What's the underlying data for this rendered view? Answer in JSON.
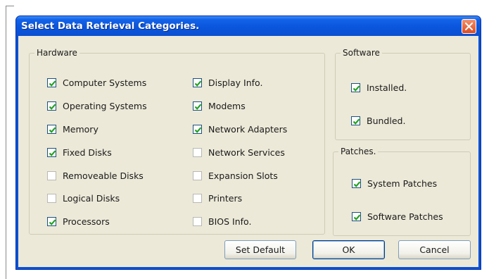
{
  "window": {
    "title": "Select Data Retrieval Categories."
  },
  "hardware": {
    "legend": "Hardware",
    "left_items": [
      {
        "label": "Computer Systems",
        "checked": true
      },
      {
        "label": "Operating Systems",
        "checked": true
      },
      {
        "label": "Memory",
        "checked": true
      },
      {
        "label": "Fixed Disks",
        "checked": true
      },
      {
        "label": "Removeable Disks",
        "checked": false
      },
      {
        "label": "Logical Disks",
        "checked": false
      },
      {
        "label": "Processors",
        "checked": true
      }
    ],
    "right_items": [
      {
        "label": "Display Info.",
        "checked": true
      },
      {
        "label": "Modems",
        "checked": true
      },
      {
        "label": "Network Adapters",
        "checked": true
      },
      {
        "label": "Network Services",
        "checked": false
      },
      {
        "label": "Expansion Slots",
        "checked": false
      },
      {
        "label": "Printers",
        "checked": false
      },
      {
        "label": "BIOS Info.",
        "checked": false
      }
    ]
  },
  "software": {
    "legend": "Software",
    "items": [
      {
        "label": "Installed.",
        "checked": true
      },
      {
        "label": "Bundled.",
        "checked": true
      }
    ]
  },
  "patches": {
    "legend": "Patches.",
    "items": [
      {
        "label": "System Patches",
        "checked": true
      },
      {
        "label": "Software Patches",
        "checked": true
      }
    ]
  },
  "buttons": {
    "set_default": "Set Default",
    "ok": "OK",
    "cancel": "Cancel"
  },
  "colors": {
    "titlebar": "#0a56dc",
    "dialog_face": "#ece9d8",
    "checkmark": "#21a121",
    "close_button": "#e04a1f"
  },
  "icons": {
    "close": "close-icon",
    "check": "checkmark-icon"
  }
}
